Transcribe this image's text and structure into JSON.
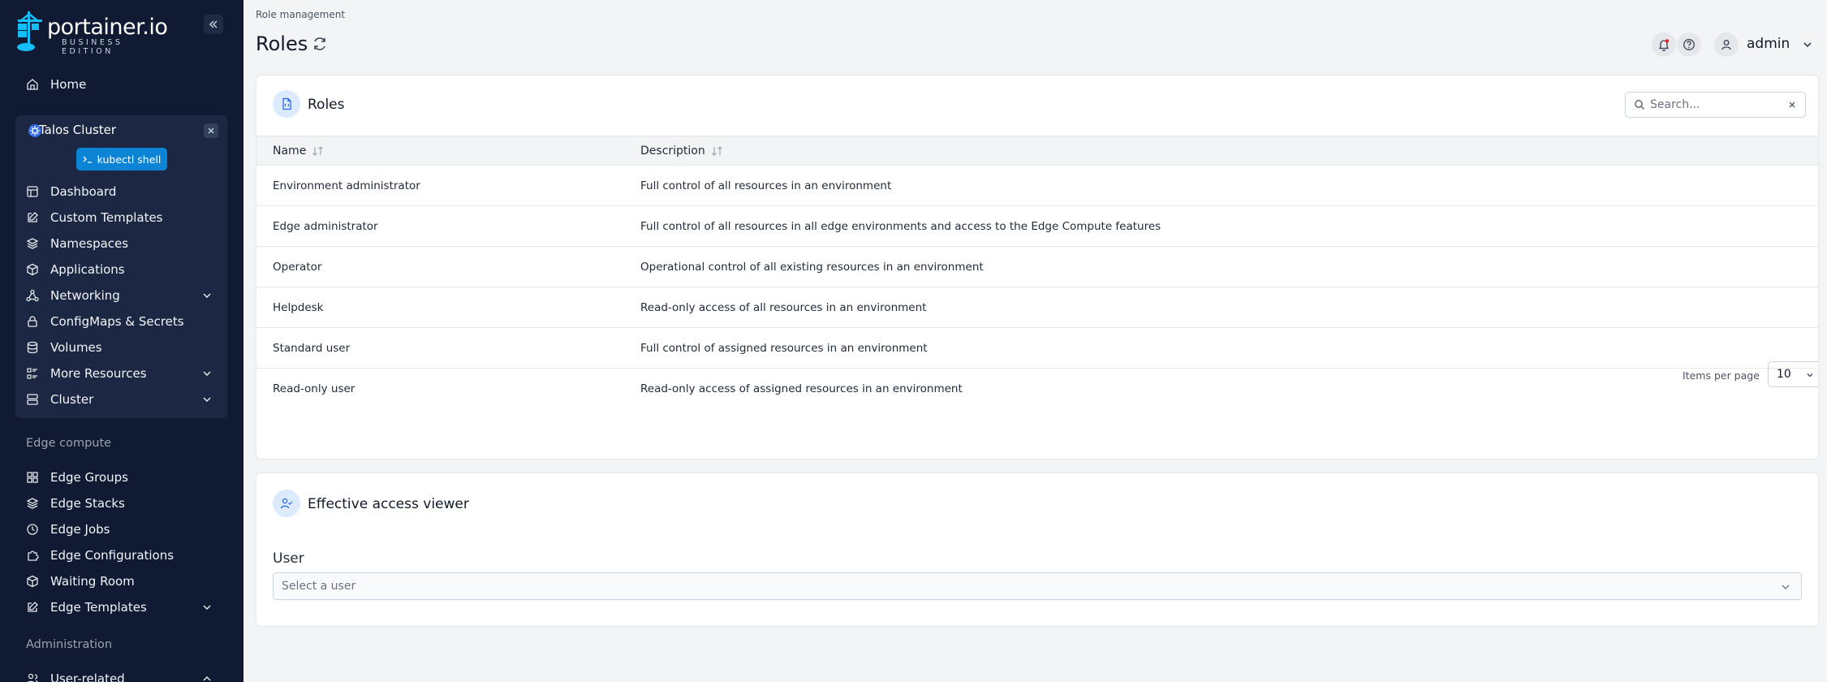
{
  "brand": {
    "name": "portainer.io",
    "edition": "BUSINESS EDITION",
    "accent": "#0b84d6",
    "sidebar_bg": "#101a33"
  },
  "sidebar": {
    "home": "Home",
    "environment": {
      "name": "Talos Cluster",
      "shell_button": "kubectl shell",
      "items": [
        {
          "label": "Dashboard",
          "icon": "dashboard-icon"
        },
        {
          "label": "Custom Templates",
          "icon": "edit-icon"
        },
        {
          "label": "Namespaces",
          "icon": "layers-icon"
        },
        {
          "label": "Applications",
          "icon": "box-icon"
        },
        {
          "label": "Networking",
          "icon": "network-icon"
        },
        {
          "label": "ConfigMaps & Secrets",
          "icon": "lock-icon"
        },
        {
          "label": "Volumes",
          "icon": "database-icon"
        },
        {
          "label": "More Resources",
          "icon": "list-icon"
        },
        {
          "label": "Cluster",
          "icon": "server-icon"
        }
      ]
    },
    "edge_section": "Edge compute",
    "edge_items": [
      {
        "label": "Edge Groups",
        "icon": "grid-icon"
      },
      {
        "label": "Edge Stacks",
        "icon": "layers-icon"
      },
      {
        "label": "Edge Jobs",
        "icon": "clock-icon"
      },
      {
        "label": "Edge Configurations",
        "icon": "puzzle-icon"
      },
      {
        "label": "Waiting Room",
        "icon": "box-icon"
      },
      {
        "label": "Edge Templates",
        "icon": "edit-icon"
      }
    ],
    "admin_section": "Administration",
    "admin_items": [
      {
        "label": "User-related",
        "icon": "users-icon"
      }
    ]
  },
  "header": {
    "breadcrumb": "Role management",
    "title": "Roles",
    "user": "admin"
  },
  "roles_card": {
    "title": "Roles",
    "search_placeholder": "Search...",
    "columns": [
      "Name",
      "Description"
    ],
    "rows": [
      {
        "name": "Environment administrator",
        "description": "Full control of all resources in an environment"
      },
      {
        "name": "Edge administrator",
        "description": "Full control of all resources in all edge environments and access to the Edge Compute features"
      },
      {
        "name": "Operator",
        "description": "Operational control of all existing resources in an environment"
      },
      {
        "name": "Helpdesk",
        "description": "Read-only access of all resources in an environment"
      },
      {
        "name": "Standard user",
        "description": "Full control of assigned resources in an environment"
      },
      {
        "name": "Read-only user",
        "description": "Read-only access of assigned resources in an environment"
      }
    ],
    "items_per_page_label": "Items per page",
    "items_per_page": "10"
  },
  "access_card": {
    "title": "Effective access viewer",
    "user_label": "User",
    "user_placeholder": "Select a user"
  }
}
